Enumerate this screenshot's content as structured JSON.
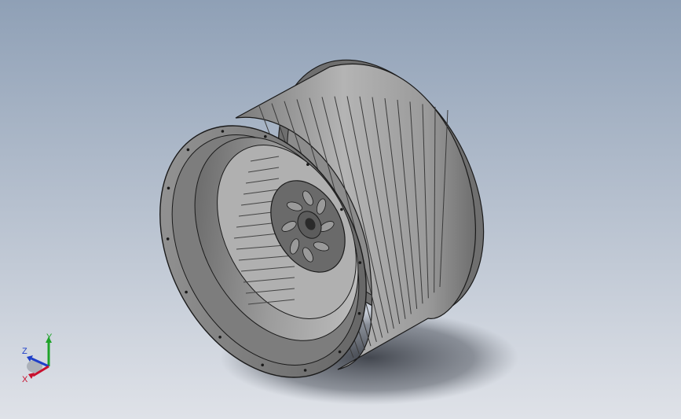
{
  "viewport": {
    "background_top": "#8fa0b6",
    "background_bottom": "#dfe2e8"
  },
  "model": {
    "part_color": "#8a8a8a",
    "edge_color": "#1a1a1a"
  },
  "triad": {
    "x_label": "X",
    "y_label": "Y",
    "z_label": "Z",
    "x_color": "#c8102e",
    "y_color": "#1fa32a",
    "z_color": "#1f3fc8"
  }
}
